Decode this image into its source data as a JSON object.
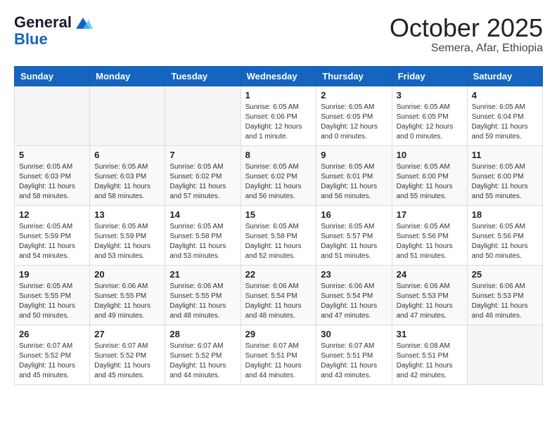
{
  "header": {
    "logo_line1": "General",
    "logo_line2": "Blue",
    "main_title": "October 2025",
    "subtitle": "Semera, Afar, Ethiopia"
  },
  "days_of_week": [
    "Sunday",
    "Monday",
    "Tuesday",
    "Wednesday",
    "Thursday",
    "Friday",
    "Saturday"
  ],
  "weeks": [
    [
      {
        "day": "",
        "info": ""
      },
      {
        "day": "",
        "info": ""
      },
      {
        "day": "",
        "info": ""
      },
      {
        "day": "1",
        "info": "Sunrise: 6:05 AM\nSunset: 6:06 PM\nDaylight: 12 hours\nand 1 minute."
      },
      {
        "day": "2",
        "info": "Sunrise: 6:05 AM\nSunset: 6:05 PM\nDaylight: 12 hours\nand 0 minutes."
      },
      {
        "day": "3",
        "info": "Sunrise: 6:05 AM\nSunset: 6:05 PM\nDaylight: 12 hours\nand 0 minutes."
      },
      {
        "day": "4",
        "info": "Sunrise: 6:05 AM\nSunset: 6:04 PM\nDaylight: 11 hours\nand 59 minutes."
      }
    ],
    [
      {
        "day": "5",
        "info": "Sunrise: 6:05 AM\nSunset: 6:03 PM\nDaylight: 11 hours\nand 58 minutes."
      },
      {
        "day": "6",
        "info": "Sunrise: 6:05 AM\nSunset: 6:03 PM\nDaylight: 11 hours\nand 58 minutes."
      },
      {
        "day": "7",
        "info": "Sunrise: 6:05 AM\nSunset: 6:02 PM\nDaylight: 11 hours\nand 57 minutes."
      },
      {
        "day": "8",
        "info": "Sunrise: 6:05 AM\nSunset: 6:02 PM\nDaylight: 11 hours\nand 56 minutes."
      },
      {
        "day": "9",
        "info": "Sunrise: 6:05 AM\nSunset: 6:01 PM\nDaylight: 11 hours\nand 56 minutes."
      },
      {
        "day": "10",
        "info": "Sunrise: 6:05 AM\nSunset: 6:00 PM\nDaylight: 11 hours\nand 55 minutes."
      },
      {
        "day": "11",
        "info": "Sunrise: 6:05 AM\nSunset: 6:00 PM\nDaylight: 11 hours\nand 55 minutes."
      }
    ],
    [
      {
        "day": "12",
        "info": "Sunrise: 6:05 AM\nSunset: 5:59 PM\nDaylight: 11 hours\nand 54 minutes."
      },
      {
        "day": "13",
        "info": "Sunrise: 6:05 AM\nSunset: 5:59 PM\nDaylight: 11 hours\nand 53 minutes."
      },
      {
        "day": "14",
        "info": "Sunrise: 6:05 AM\nSunset: 5:58 PM\nDaylight: 11 hours\nand 53 minutes."
      },
      {
        "day": "15",
        "info": "Sunrise: 6:05 AM\nSunset: 5:58 PM\nDaylight: 11 hours\nand 52 minutes."
      },
      {
        "day": "16",
        "info": "Sunrise: 6:05 AM\nSunset: 5:57 PM\nDaylight: 11 hours\nand 51 minutes."
      },
      {
        "day": "17",
        "info": "Sunrise: 6:05 AM\nSunset: 5:56 PM\nDaylight: 11 hours\nand 51 minutes."
      },
      {
        "day": "18",
        "info": "Sunrise: 6:05 AM\nSunset: 5:56 PM\nDaylight: 11 hours\nand 50 minutes."
      }
    ],
    [
      {
        "day": "19",
        "info": "Sunrise: 6:05 AM\nSunset: 5:55 PM\nDaylight: 11 hours\nand 50 minutes."
      },
      {
        "day": "20",
        "info": "Sunrise: 6:06 AM\nSunset: 5:55 PM\nDaylight: 11 hours\nand 49 minutes."
      },
      {
        "day": "21",
        "info": "Sunrise: 6:06 AM\nSunset: 5:55 PM\nDaylight: 11 hours\nand 48 minutes."
      },
      {
        "day": "22",
        "info": "Sunrise: 6:06 AM\nSunset: 5:54 PM\nDaylight: 11 hours\nand 48 minutes."
      },
      {
        "day": "23",
        "info": "Sunrise: 6:06 AM\nSunset: 5:54 PM\nDaylight: 11 hours\nand 47 minutes."
      },
      {
        "day": "24",
        "info": "Sunrise: 6:06 AM\nSunset: 5:53 PM\nDaylight: 11 hours\nand 47 minutes."
      },
      {
        "day": "25",
        "info": "Sunrise: 6:06 AM\nSunset: 5:53 PM\nDaylight: 11 hours\nand 46 minutes."
      }
    ],
    [
      {
        "day": "26",
        "info": "Sunrise: 6:07 AM\nSunset: 5:52 PM\nDaylight: 11 hours\nand 45 minutes."
      },
      {
        "day": "27",
        "info": "Sunrise: 6:07 AM\nSunset: 5:52 PM\nDaylight: 11 hours\nand 45 minutes."
      },
      {
        "day": "28",
        "info": "Sunrise: 6:07 AM\nSunset: 5:52 PM\nDaylight: 11 hours\nand 44 minutes."
      },
      {
        "day": "29",
        "info": "Sunrise: 6:07 AM\nSunset: 5:51 PM\nDaylight: 11 hours\nand 44 minutes."
      },
      {
        "day": "30",
        "info": "Sunrise: 6:07 AM\nSunset: 5:51 PM\nDaylight: 11 hours\nand 43 minutes."
      },
      {
        "day": "31",
        "info": "Sunrise: 6:08 AM\nSunset: 5:51 PM\nDaylight: 11 hours\nand 42 minutes."
      },
      {
        "day": "",
        "info": ""
      }
    ]
  ]
}
